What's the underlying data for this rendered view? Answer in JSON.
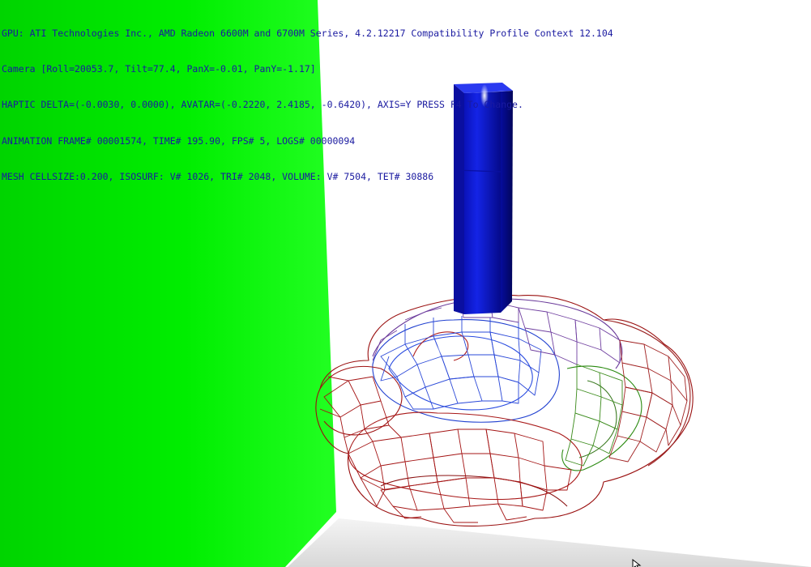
{
  "hud": {
    "lines": [
      "GPU: ATI Technologies Inc., AMD Radeon 6600M and 6700M Series, 4.2.12217 Compatibility Profile Context 12.104",
      "Camera [Roll=20053.7, Tilt=77.4, PanX=-0.01, PanY=-1.17]",
      "HAPTIC DELTA=(-0.0030, 0.0000), AVATAR=(-0.2220, 2.4185, -0.6420), AXIS=Y PRESS F4 To Change.",
      "ANIMATION FRAME# 00001574, TIME# 195.90, FPS# 5, LOGS# 00000094",
      "MESH CELLSIZE:0.200, ISOSURF: V# 1026, TRI# 2048, VOLUME: V# 7504, TET# 30886"
    ]
  },
  "colors": {
    "hud_text": "#1a1aa0",
    "background": "#ffffff",
    "green_wall": "#00ee00",
    "haptic_avatar": "#0a14c8",
    "mesh_red": "#b01010",
    "mesh_blue": "#2040d0",
    "mesh_purple": "#7a3a8a",
    "mesh_green": "#2a8a10"
  },
  "icons": {
    "cursor": "mouse-pointer-icon"
  }
}
